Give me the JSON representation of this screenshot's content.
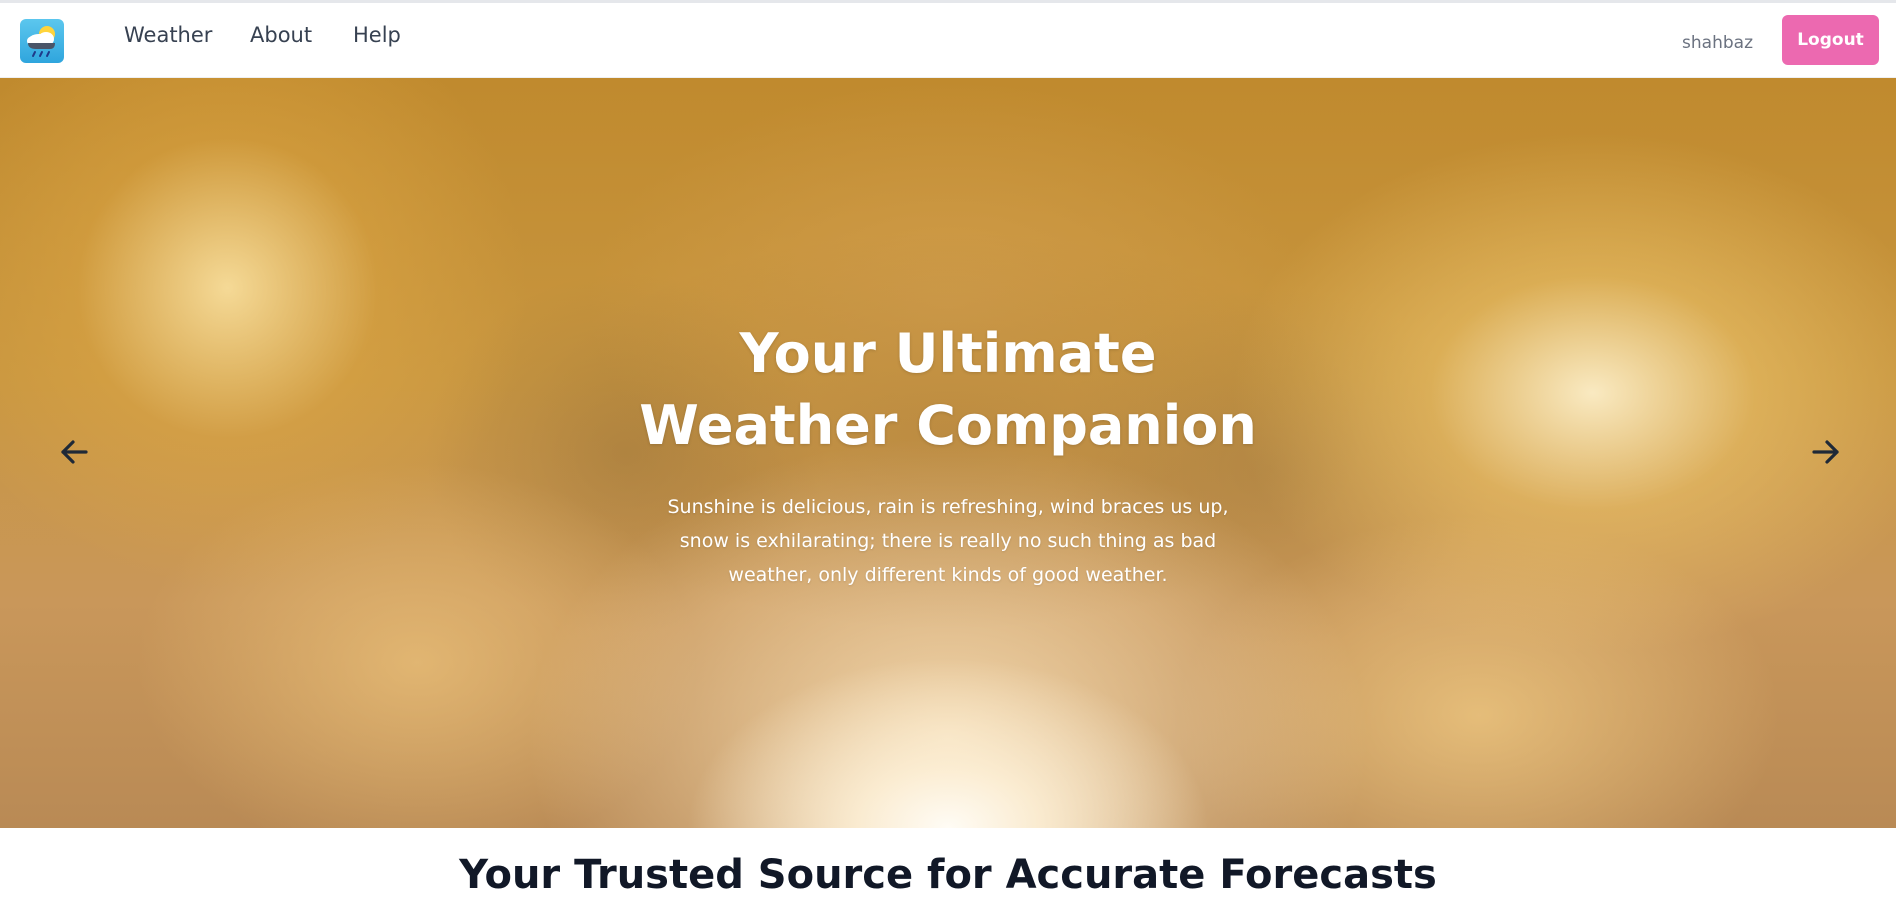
{
  "header": {
    "logo_icon": "cloud-sun-rain-icon",
    "nav": [
      {
        "label": "Weather"
      },
      {
        "label": "About"
      },
      {
        "label": "Help"
      }
    ],
    "username": "shahbaz",
    "logout_label": "Logout",
    "logout_color": "#ec69b0"
  },
  "hero": {
    "title_line1": "Your Ultimate",
    "title_line2": "Weather Companion",
    "text": "Sunshine is delicious, rain is refreshing, wind braces us up, snow is exhilarating; there is really no such thing as bad weather, only different kinds of good weather.",
    "prev_icon": "arrow-left-icon",
    "next_icon": "arrow-right-icon"
  },
  "section": {
    "title": "Your Trusted Source for Accurate Forecasts"
  }
}
